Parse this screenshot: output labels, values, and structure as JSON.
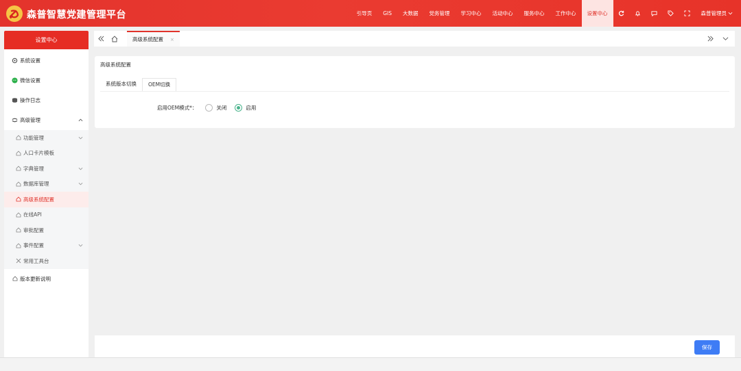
{
  "header": {
    "app_title": "森普智慧党建管理平台",
    "nav": [
      "引导页",
      "GIS",
      "大数据",
      "党务管理",
      "学习中心",
      "活动中心",
      "服务中心",
      "工作中心",
      "设置中心"
    ],
    "active_nav": "设置中心",
    "user": "森普管理员",
    "brand_color": "#e73329"
  },
  "sidebar": {
    "title": "设置中心",
    "items": [
      {
        "label": "系统设置",
        "icon": "gear-icon"
      },
      {
        "label": "微信设置",
        "icon": "wechat-icon"
      },
      {
        "label": "操作日志",
        "icon": "log-icon"
      },
      {
        "label": "高级管理",
        "icon": "advanced-icon",
        "expanded": true
      }
    ],
    "submenu": [
      {
        "label": "功能管理",
        "has_children": true
      },
      {
        "label": "人口卡片模板",
        "has_children": false
      },
      {
        "label": "字典管理",
        "has_children": true
      },
      {
        "label": "数据库管理",
        "has_children": true
      },
      {
        "label": "高级系统配置",
        "has_children": false,
        "active": true
      },
      {
        "label": "在线API",
        "has_children": false
      },
      {
        "label": "审批配置",
        "has_children": false
      },
      {
        "label": "事件配置",
        "has_children": true
      },
      {
        "label": "常用工具台",
        "has_children": false
      }
    ],
    "footer_item": "版本更新说明"
  },
  "tabs": {
    "current": "高级系统配置"
  },
  "panel": {
    "title": "高级系统配置",
    "sub_tabs": [
      "系统版本切换",
      "OEM切换"
    ],
    "active_sub_tab": "OEM切换",
    "field_label": "启用OEM模式*：",
    "options": [
      "关闭",
      "启用"
    ],
    "selected_option": "启用"
  },
  "save_label": "保存"
}
